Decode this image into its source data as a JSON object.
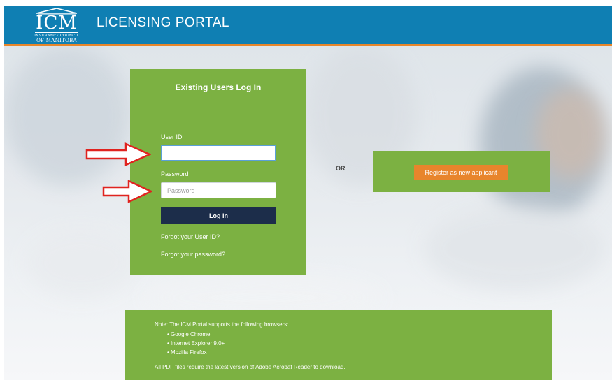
{
  "header": {
    "logo_letters": "ICM",
    "logo_line1": "INSURANCE COUNCIL",
    "logo_line2": "OF MANITOBA",
    "title": "LICENSING PORTAL"
  },
  "login": {
    "title": "Existing Users Log In",
    "user_id_label": "User ID",
    "user_id_value": "",
    "password_label": "Password",
    "password_placeholder": "Password",
    "login_button": "Log In",
    "forgot_user_id": "Forgot your User ID?",
    "forgot_password": "Forgot your password?"
  },
  "or_text": "OR",
  "register": {
    "button_label": "Register as new applicant"
  },
  "note": {
    "intro": "Note: The ICM Portal supports the following browsers:",
    "browsers": [
      "Google Chrome",
      "Internet Explorer 9.0+",
      "Mozilla Firefox"
    ],
    "pdf_note": "All PDF files require the latest version of Adobe Acrobat Reader to download."
  },
  "colors": {
    "header_blue": "#0f7fb3",
    "header_accent": "#e8862a",
    "panel_green": "#7cb142",
    "login_button": "#1c2d4a",
    "register_button": "#e8852c",
    "arrow_red": "#e0231f"
  },
  "icons": [
    "icm-logo-building-icon",
    "red-arrow-icon"
  ]
}
